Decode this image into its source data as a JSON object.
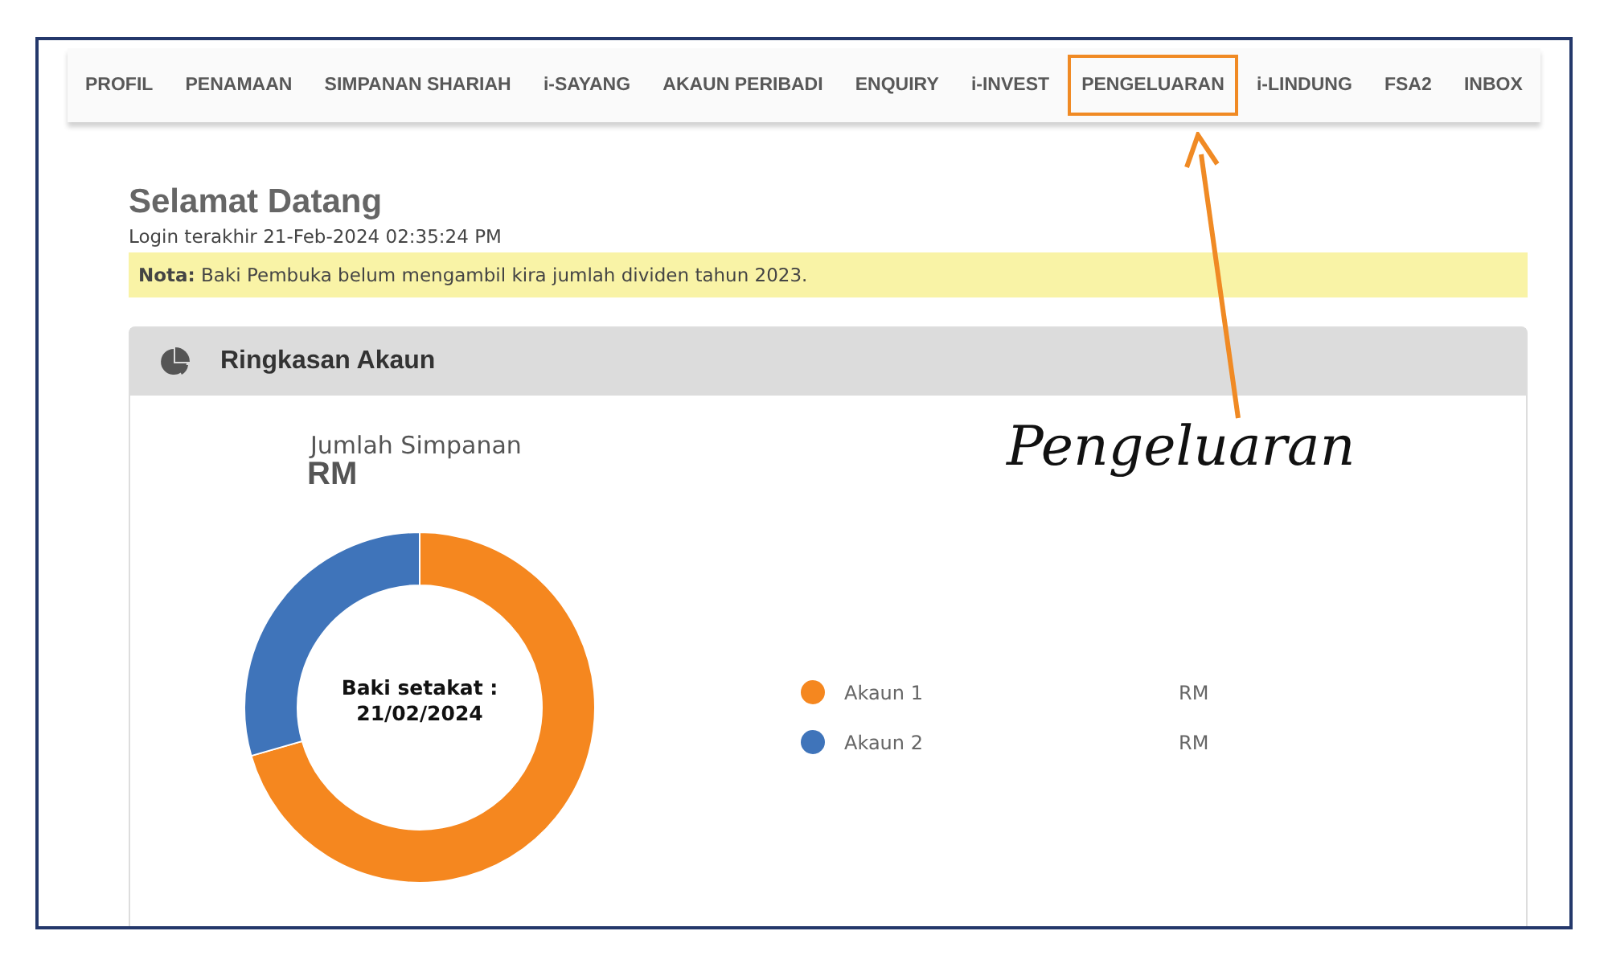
{
  "nav": {
    "items": [
      {
        "label": "PROFIL",
        "highlighted": false
      },
      {
        "label": "PENAMAAN",
        "highlighted": false
      },
      {
        "label": "SIMPANAN SHARIAH",
        "highlighted": false
      },
      {
        "label": "i-SAYANG",
        "highlighted": false
      },
      {
        "label": "AKAUN PERIBADI",
        "highlighted": false
      },
      {
        "label": "ENQUIRY",
        "highlighted": false
      },
      {
        "label": "i-INVEST",
        "highlighted": false
      },
      {
        "label": "PENGELUARAN",
        "highlighted": true
      },
      {
        "label": "i-LINDUNG",
        "highlighted": false
      },
      {
        "label": "FSA2",
        "highlighted": false
      },
      {
        "label": "INBOX",
        "highlighted": false
      }
    ]
  },
  "welcome": {
    "title": "Selamat Datang",
    "last_login": "Login terakhir 21-Feb-2024 02:35:24 PM"
  },
  "note": "**Nota:** Baki Pembuka belum mengambil kira jumlah dividen tahun 2023.",
  "summary": {
    "title": "Ringkasan Akaun",
    "total_label": "Jumlah Simpanan",
    "total_value": "RM",
    "center_label": "Baki setakat :",
    "center_date": "21/02/2024",
    "accounts": [
      {
        "name": "Akaun 1",
        "amount": "RM",
        "color": "#f5871f"
      },
      {
        "name": "Akaun 2",
        "amount": "RM",
        "color": "#3f74ba"
      }
    ]
  },
  "annotation": {
    "label": "Pengeluaran"
  }
}
